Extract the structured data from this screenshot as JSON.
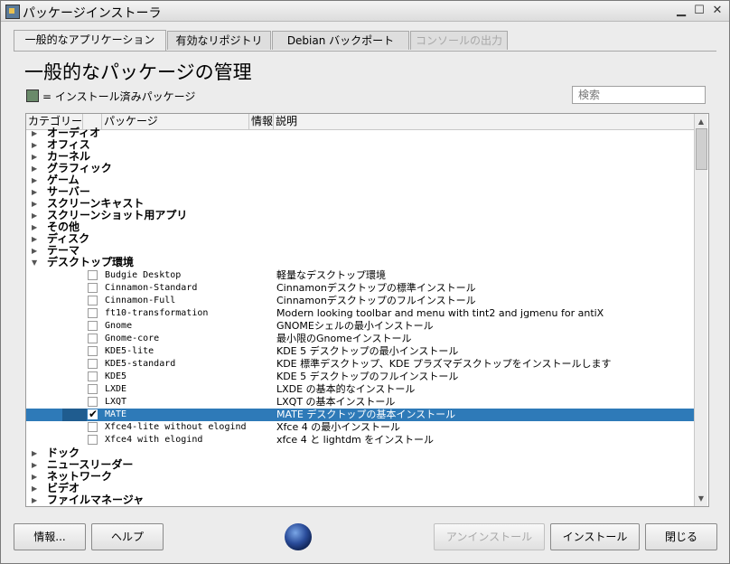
{
  "window": {
    "title": "パッケージインストーラ"
  },
  "tabs": [
    {
      "label": "一般的なアプリケーション",
      "state": "active"
    },
    {
      "label": "有効なリポジトリ",
      "state": "normal"
    },
    {
      "label": "Debian バックポート",
      "state": "normal"
    },
    {
      "label": "コンソールの出力",
      "state": "disabled"
    }
  ],
  "main": {
    "title": "一般的なパッケージの管理",
    "legend": "= インストール済みパッケージ",
    "search_placeholder": "検索"
  },
  "tree": {
    "headers": {
      "category": "カテゴリー",
      "package": "パッケージ",
      "info": "情報",
      "description": "説明"
    },
    "categories_before": [
      "オーディオ",
      "オフィス",
      "カーネル",
      "グラフィック",
      "ゲーム",
      "サーバー",
      "スクリーンキャスト",
      "スクリーンショット用アプリ",
      "その他",
      "ディスク",
      "テーマ"
    ],
    "expanded_category": "デスクトップ環境",
    "packages": [
      {
        "name": "Budgie Desktop",
        "desc": "軽量なデスクトップ環境",
        "checked": false,
        "selected": false
      },
      {
        "name": "Cinnamon-Standard",
        "desc": "Cinnamonデスクトップの標準インストール",
        "checked": false,
        "selected": false
      },
      {
        "name": "Cinnamon-Full",
        "desc": "Cinnamonデスクトップのフルインストール",
        "checked": false,
        "selected": false
      },
      {
        "name": "ft10-transformation",
        "desc": "Modern looking toolbar and menu with tint2 and jgmenu for antiX",
        "checked": false,
        "selected": false
      },
      {
        "name": "Gnome",
        "desc": "GNOMEシェルの最小インストール",
        "checked": false,
        "selected": false
      },
      {
        "name": "Gnome-core",
        "desc": "最小限のGnomeインストール",
        "checked": false,
        "selected": false
      },
      {
        "name": "KDE5-lite",
        "desc": "KDE 5 デスクトップの最小インストール",
        "checked": false,
        "selected": false
      },
      {
        "name": "KDE5-standard",
        "desc": "KDE 標準デスクトップ、KDE プラズマデスクトップをインストールします",
        "checked": false,
        "selected": false
      },
      {
        "name": "KDE5",
        "desc": "KDE 5 デスクトップのフルインストール",
        "checked": false,
        "selected": false
      },
      {
        "name": "LXDE",
        "desc": "LXDE の基本的なインストール",
        "checked": false,
        "selected": false
      },
      {
        "name": "LXQT",
        "desc": "LXQT の基本インストール",
        "checked": false,
        "selected": false
      },
      {
        "name": "MATE",
        "desc": "MATE デスクトップの基本インストール",
        "checked": true,
        "selected": true
      },
      {
        "name": "Xfce4-lite without elogind",
        "desc": "Xfce 4 の最小インストール",
        "checked": false,
        "selected": false
      },
      {
        "name": "Xfce4 with elogind",
        "desc": "xfce 4 と lightdm をインストール",
        "checked": false,
        "selected": false
      }
    ],
    "categories_after": [
      "ドック",
      "ニュースリーダー",
      "ネットワーク",
      "ビデオ",
      "ファイルマネージャ"
    ]
  },
  "buttons": {
    "info": "情報...",
    "help": "ヘルプ",
    "uninstall": "アンインストール",
    "install": "インストール",
    "close": "閉じる"
  },
  "colors": {
    "selection": "#2e7ab8",
    "installed_marker": "#6a8a6a"
  }
}
